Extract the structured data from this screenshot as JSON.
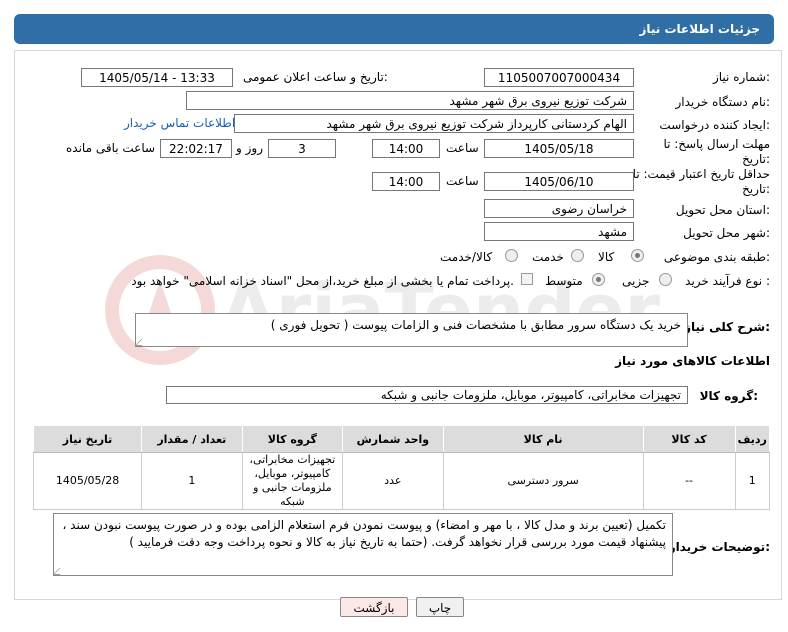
{
  "header": {
    "title": "جزئیات اطلاعات نیاز"
  },
  "form": {
    "need_number_label": "شماره نیاز:",
    "need_number": "1105007007000434",
    "announce_label": "تاریخ و ساعت اعلان عمومی:",
    "announce_value": "1405/05/14 - 13:33",
    "buyer_org_label": "نام دستگاه خریدار:",
    "buyer_org": "شرکت توزیع نیروی برق شهر مشهد",
    "creator_label": "ایجاد کننده درخواست:",
    "creator": "الهام کردستانی کارپرداز شرکت توزیع نیروی برق شهر مشهد",
    "contact_link": "اطلاعات تماس خریدار",
    "reply_label": "مهلت ارسال پاسخ: تا تاریخ:",
    "reply_date": "1405/05/18",
    "time_label": "ساعت",
    "reply_time": "14:00",
    "days": "3",
    "days_label": "روز و",
    "remaining": "22:02:17",
    "remaining_label": "ساعت باقی مانده",
    "validity_label": "حداقل تاریخ اعتبار قیمت: تا تاریخ:",
    "validity_date": "1405/06/10",
    "validity_time": "14:00",
    "province_label": "استان محل تحویل:",
    "province": "خراسان رضوی",
    "city_label": "شهر محل تحویل:",
    "city": "مشهد",
    "category_label": "طبقه بندی موضوعی:",
    "category_options": [
      "کالا",
      "خدمت",
      "کالا/خدمت"
    ],
    "process_label": "نوع فرآیند خرید :",
    "process_options": [
      "جزیی",
      "متوسط"
    ],
    "payment_note": "پرداخت تمام یا بخشی از مبلغ خرید،از محل \"اسناد خزانه اسلامی\" خواهد بود."
  },
  "summary": {
    "label": "شرح کلی نیاز:",
    "text": "خرید یک دستگاه سرور مطابق با مشخصات فنی و الزامات پیوست ( تحویل فوری )"
  },
  "goods": {
    "section_title": "اطلاعات کالاهای مورد نیاز",
    "group_label": "گروه کالا:",
    "group_value": "تجهیزات مخابراتی، کامپیوتر، موبایل، ملزومات جانبی و شبکه",
    "columns": [
      "ردیف",
      "کد کالا",
      "نام کالا",
      "واحد شمارش",
      "گروه کالا",
      "تعداد / مقدار",
      "تاریخ نیاز"
    ],
    "rows": [
      {
        "row": "1",
        "code": "--",
        "name": "سرور دسترسی",
        "unit": "عدد",
        "group": "تجهیزات مخابراتی، کامپیوتر، موبایل، ملزومات جانبی و شبکه",
        "qty": "1",
        "date": "1405/05/28"
      }
    ]
  },
  "buyer_notes": {
    "label": "توضیحات خریدار:",
    "text": "تکمیل (تعیین برند و مدل کالا ، با مهر و امضاء) و پیوست نمودن فرم استعلام الزامی بوده و در صورت پیوست نبودن سند ، پیشنهاد قیمت مورد بررسی قرار نخواهد گرفت. (حتما به تاریخ نیاز به کالا و نحوه پرداخت وجه دقت فرمایید )"
  },
  "buttons": {
    "print": "چاپ",
    "back": "بازگشت"
  },
  "watermark": {
    "text": "AriaTender.neT"
  },
  "colors": {
    "header": "#2f6fa6",
    "link": "#1a5fb4",
    "back_button": "#fde8e8"
  }
}
